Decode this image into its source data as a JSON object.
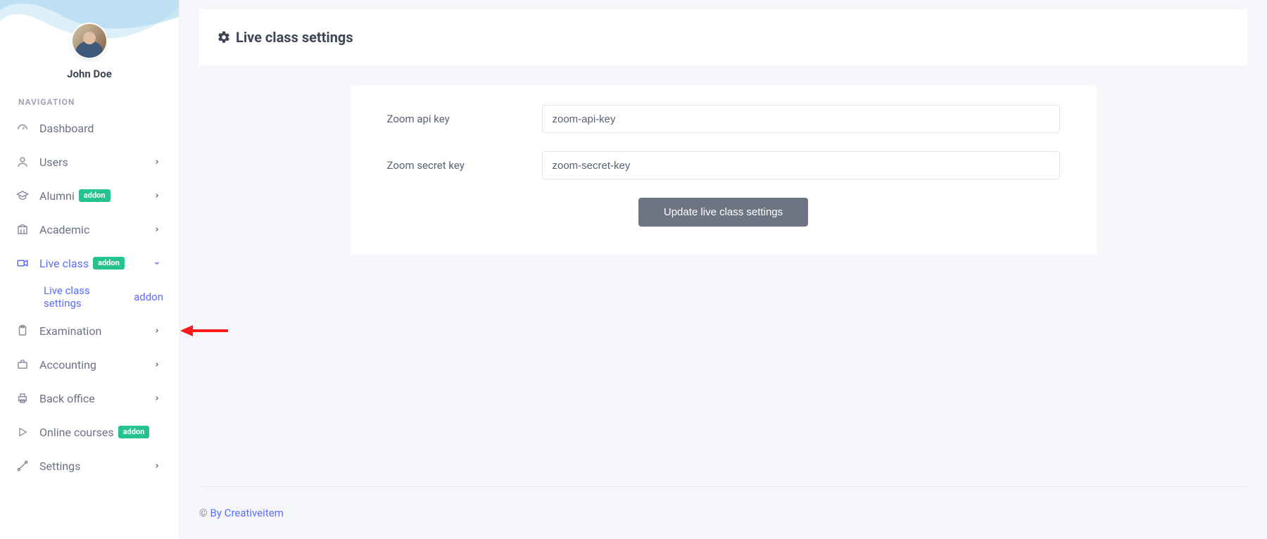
{
  "user": {
    "name": "John Doe"
  },
  "nav_header": "NAVIGATION",
  "addon_label": "addon",
  "nav": {
    "dashboard": "Dashboard",
    "users": "Users",
    "alumni": "Alumni",
    "academic": "Academic",
    "live_class": "Live class",
    "live_class_settings": "Live class settings",
    "examination": "Examination",
    "accounting": "Accounting",
    "back_office": "Back office",
    "online_courses": "Online courses",
    "settings": "Settings"
  },
  "page": {
    "title": "Live class settings"
  },
  "form": {
    "zoom_api_label": "Zoom api key",
    "zoom_api_value": "zoom-api-key",
    "zoom_secret_label": "Zoom secret key",
    "zoom_secret_value": "zoom-secret-key",
    "submit_label": "Update live class settings"
  },
  "footer": {
    "copy": "© ",
    "by": "By Creativeitem"
  }
}
